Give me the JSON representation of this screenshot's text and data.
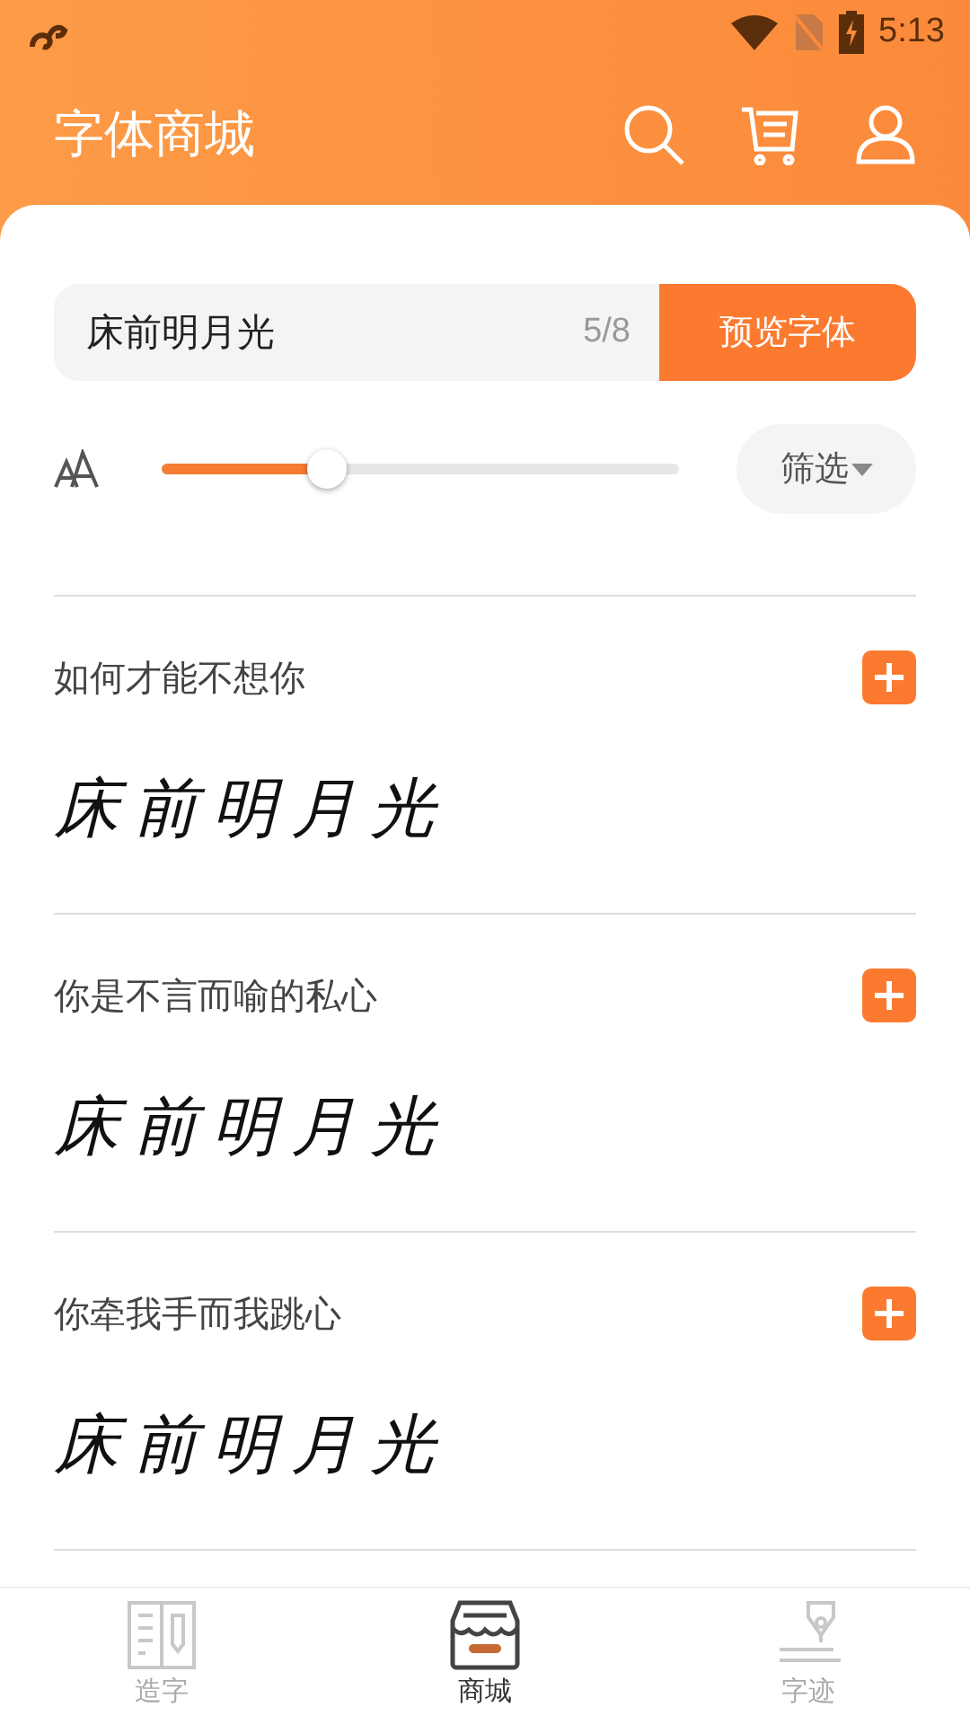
{
  "status_bar": {
    "time": "5:13"
  },
  "header": {
    "title": "字体商城"
  },
  "preview": {
    "text": "床前明月光",
    "counter": "5/8",
    "button": "预览字体"
  },
  "size_slider": {
    "level": 0.32
  },
  "filter": {
    "label": "筛选"
  },
  "fonts": [
    {
      "name": "如何才能不想你",
      "sample": "床前明月光"
    },
    {
      "name": "你是不言而喻的私心",
      "sample": "床前明月光"
    },
    {
      "name": "你牵我手而我跳心",
      "sample": "床前明月光"
    }
  ],
  "nav": [
    {
      "label": "造字",
      "kind": "book",
      "selected": false
    },
    {
      "label": "商城",
      "kind": "shop",
      "selected": true
    },
    {
      "label": "字迹",
      "kind": "pen",
      "selected": false
    }
  ]
}
